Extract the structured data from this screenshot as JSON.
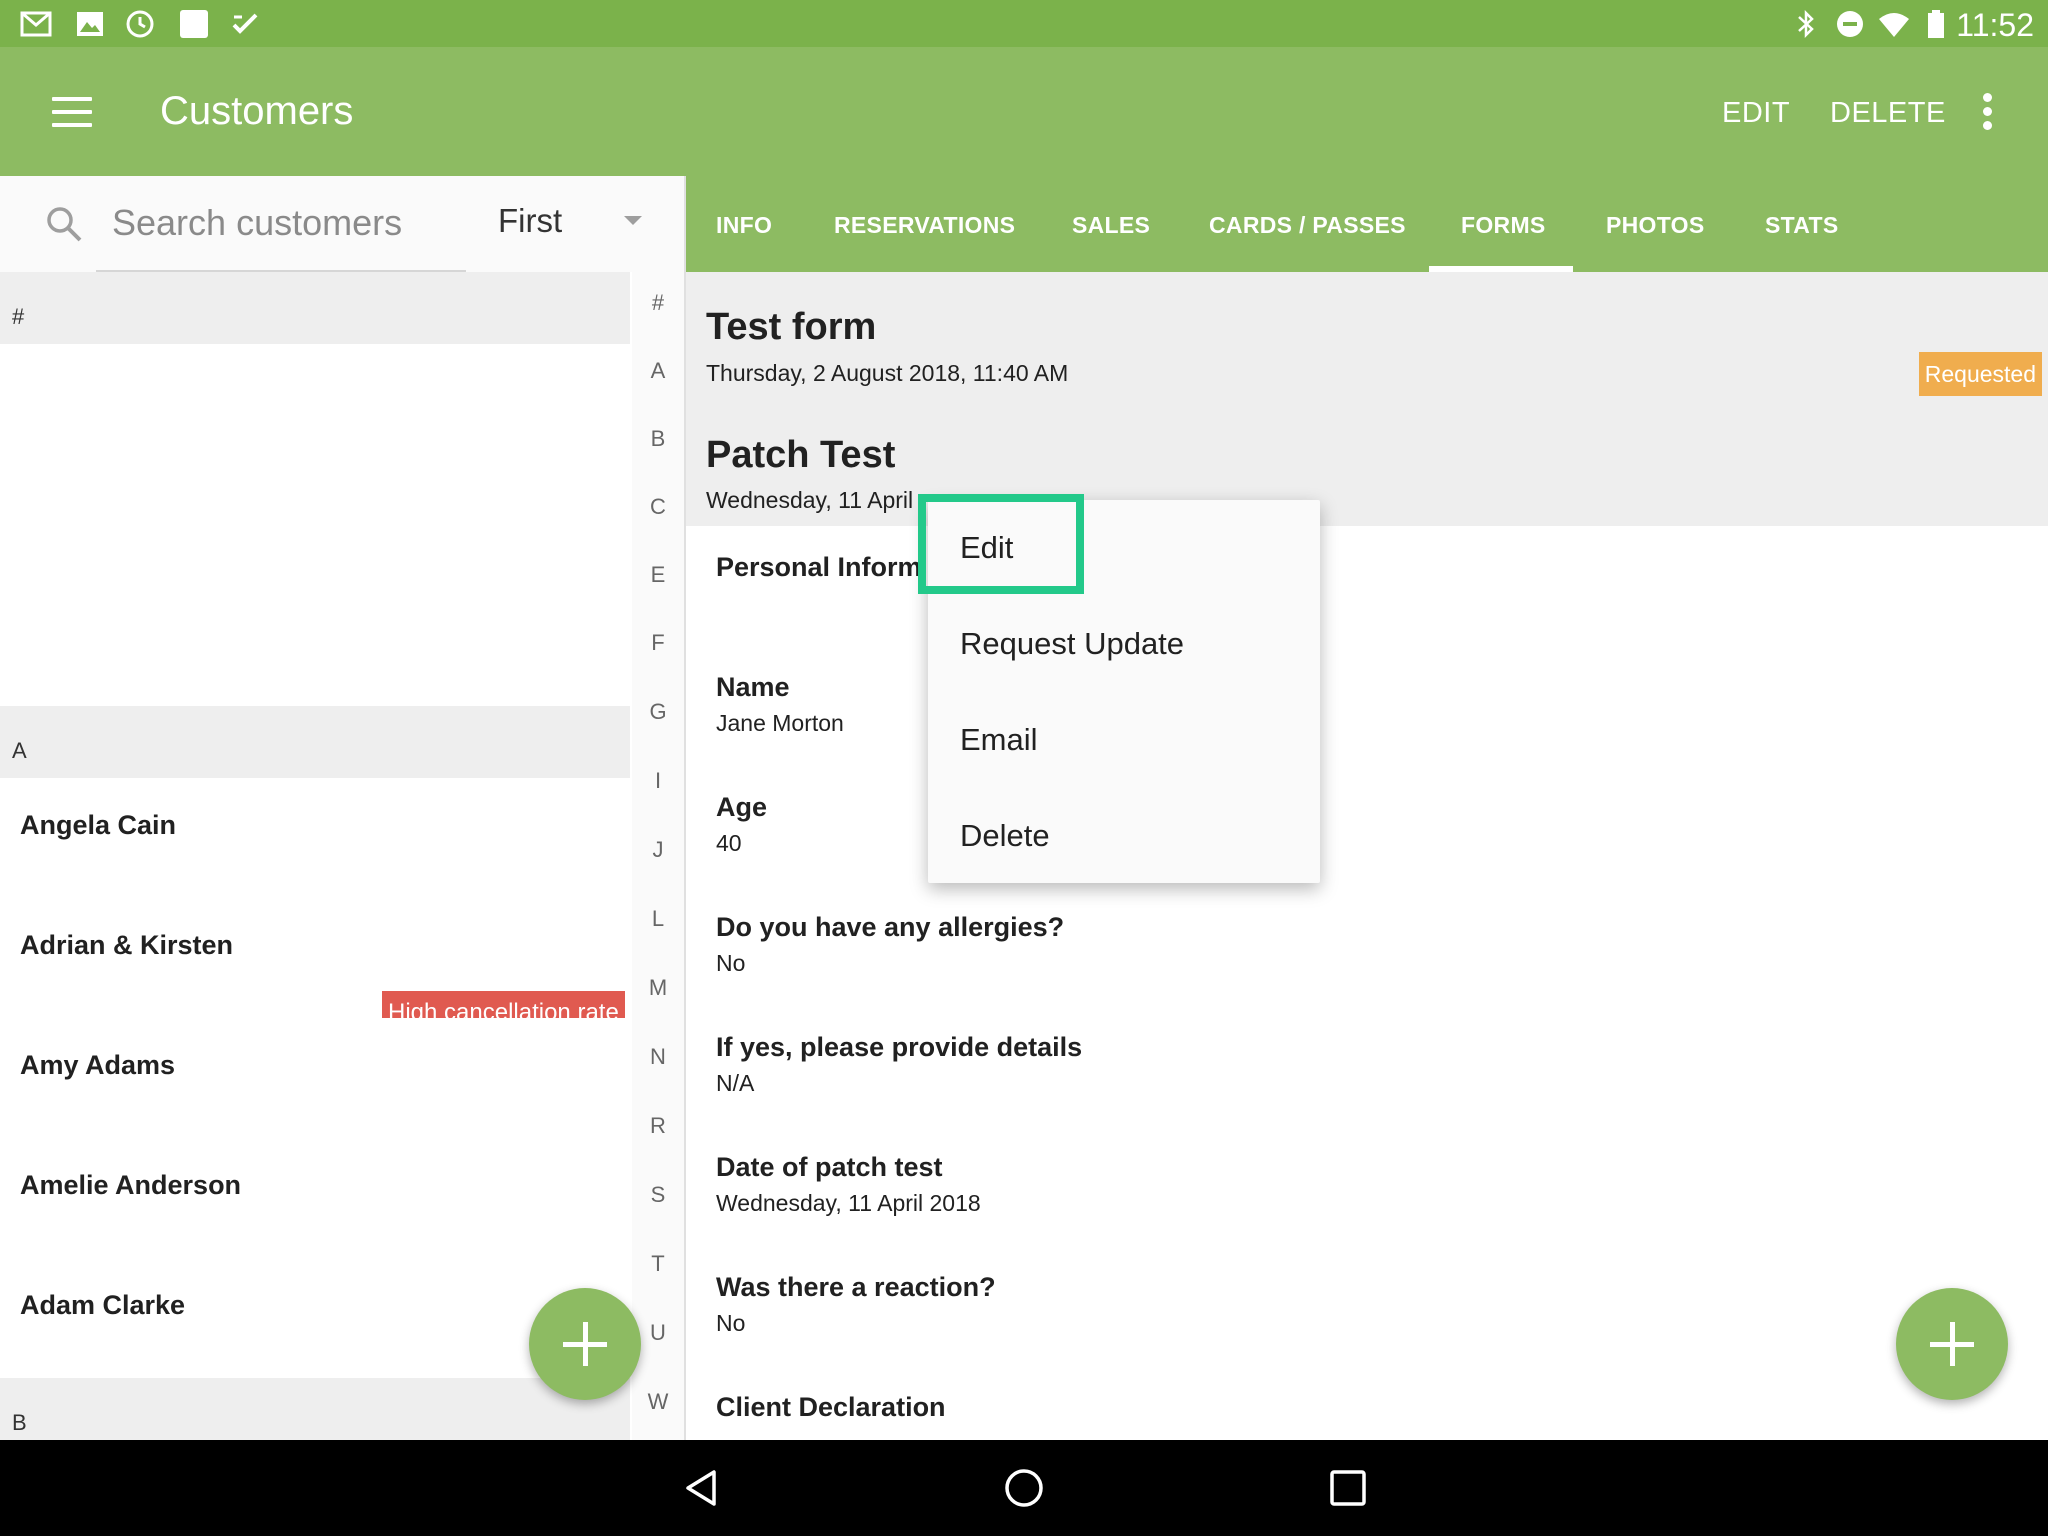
{
  "status_bar": {
    "time": "11:52",
    "left_icons": [
      "gmail-icon",
      "photos-icon",
      "clock-icon",
      "square-app-icon",
      "checklist-icon"
    ],
    "right_icons": [
      "bluetooth-icon",
      "do-not-disturb-icon",
      "wifi-icon",
      "battery-icon"
    ]
  },
  "app_bar": {
    "title": "Customers",
    "edit_label": "EDIT",
    "delete_label": "DELETE"
  },
  "search": {
    "placeholder": "Search customers",
    "sort_value": "First"
  },
  "customer_list": {
    "sections": [
      {
        "header": "#",
        "customers": []
      },
      {
        "header": "A",
        "customers": [
          {
            "name": "Angela Cain"
          },
          {
            "name": "Adrian & Kirsten",
            "badge": "High cancellation rate"
          },
          {
            "name": "Amy Adams"
          },
          {
            "name": "Amelie Anderson"
          },
          {
            "name": "Adam Clarke"
          }
        ]
      },
      {
        "header": "B",
        "customers": []
      }
    ]
  },
  "index_letters": [
    "#",
    "A",
    "B",
    "C",
    "E",
    "F",
    "G",
    "I",
    "J",
    "L",
    "M",
    "N",
    "R",
    "S",
    "T",
    "U",
    "W"
  ],
  "tabs": [
    "INFO",
    "RESERVATIONS",
    "SALES",
    "CARDS / PASSES",
    "FORMS",
    "PHOTOS",
    "STATS"
  ],
  "active_tab": "FORMS",
  "forms": [
    {
      "title": "Test form",
      "date": "Thursday, 2 August 2018, 11:40 AM",
      "status": "Requested"
    },
    {
      "title": "Patch Test",
      "date": "Wednesday, 11 April"
    }
  ],
  "form_section_title": "Personal Inform",
  "form_fields": [
    {
      "label": "Name",
      "value": "Jane Morton"
    },
    {
      "label": "Age",
      "value": "40"
    },
    {
      "label": "Do you have any allergies?",
      "value": "No"
    },
    {
      "label": "If yes, please provide details",
      "value": "N/A"
    },
    {
      "label": "Date of patch test",
      "value": "Wednesday, 11 April 2018"
    },
    {
      "label": "Was there a reaction?",
      "value": "No"
    },
    {
      "label": "Client Declaration",
      "value": ""
    }
  ],
  "popup_menu": {
    "items": [
      "Edit",
      "Request Update",
      "Email",
      "Delete"
    ],
    "highlighted": "Edit"
  },
  "colors": {
    "status_bar": "#7bb24b",
    "primary": "#8dbb62",
    "badge_red": "#e05a50",
    "badge_orange": "#f0ad4e",
    "highlight": "#23c98a"
  }
}
